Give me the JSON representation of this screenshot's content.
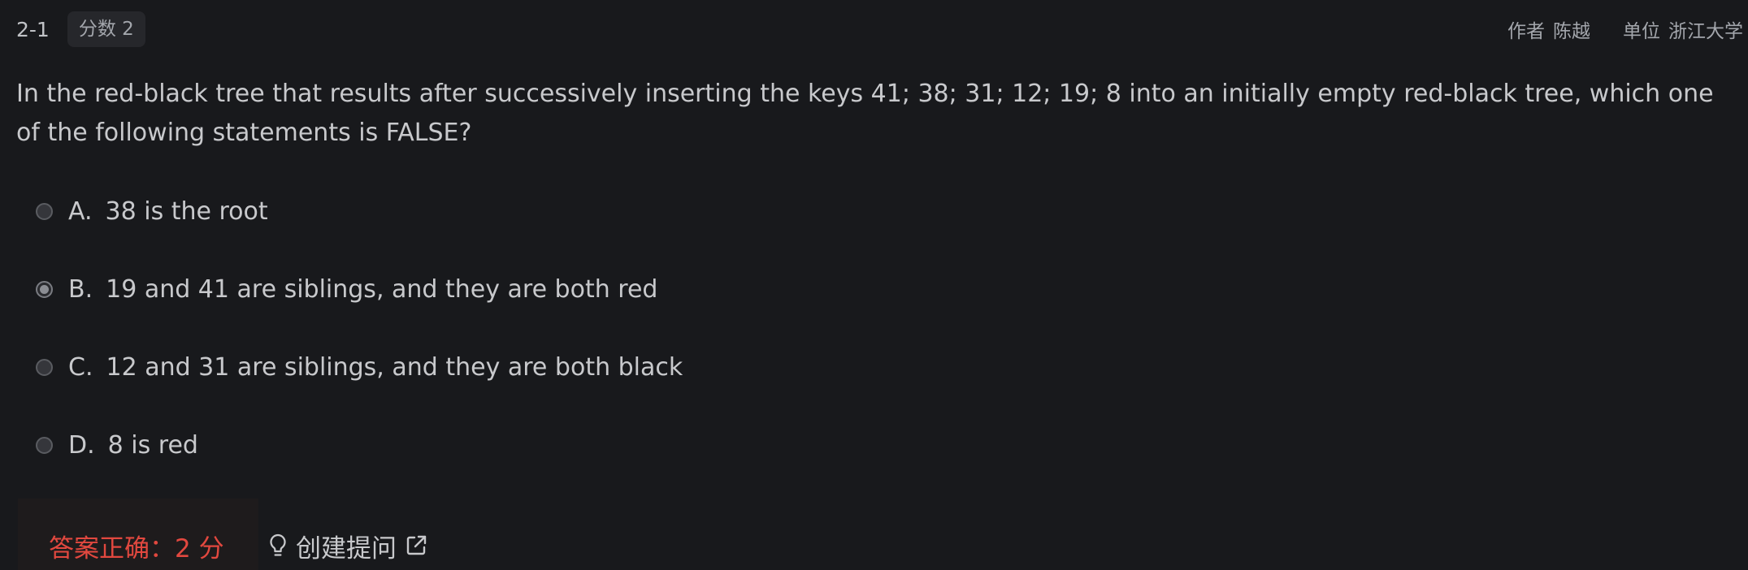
{
  "header": {
    "question_number": "2-1",
    "score_tag": "分数 2",
    "author_label": "作者",
    "author_name": "陈越",
    "unit_label": "单位",
    "unit_name": "浙江大学"
  },
  "question": {
    "text": "In the red-black tree that results after successively inserting the keys 41; 38; 31; 12; 19; 8 into an initially empty red-black tree, which one of the following statements is FALSE?"
  },
  "options": [
    {
      "letter": "A.",
      "text": "38 is the root",
      "selected": false
    },
    {
      "letter": "B.",
      "text": "19 and 41 are siblings, and they are both red",
      "selected": true
    },
    {
      "letter": "C.",
      "text": "12 and 31 are siblings, and they are both black",
      "selected": false
    },
    {
      "letter": "D.",
      "text": "8 is red",
      "selected": false
    }
  ],
  "result": {
    "text": "答案正确：2 分"
  },
  "hint": {
    "label": "创建提问",
    "icon": "lightbulb-icon",
    "link_icon": "external-link-icon"
  },
  "colors": {
    "background": "#18191c",
    "correct_red": "#e2483f"
  }
}
